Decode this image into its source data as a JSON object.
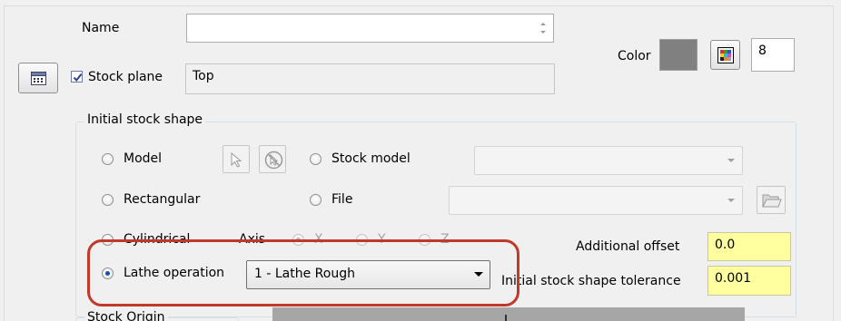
{
  "name": {
    "label": "Name",
    "value": ""
  },
  "color": {
    "label": "Color",
    "swatch": "#808080",
    "value": "8"
  },
  "stock_plane": {
    "label": "Stock plane",
    "checked": true,
    "value": "Top"
  },
  "initial_stock_shape": {
    "group_title": "Initial stock shape",
    "model_label": "Model",
    "stock_model_label": "Stock model",
    "stock_model_value": "",
    "rectangular_label": "Rectangular",
    "file_label": "File",
    "file_value": "",
    "cylindrical_label": "Cylindrical",
    "axis_label": "Axis",
    "axis_x": "X",
    "axis_y": "Y",
    "axis_z": "Z",
    "lathe_operation_label": "Lathe operation",
    "lathe_operation_value": "1 - Lathe Rough",
    "additional_offset_label": "Additional offset",
    "additional_offset_value": "0.0",
    "tolerance_label": "Initial stock shape tolerance",
    "tolerance_value": "0.001"
  },
  "stock_origin": {
    "group_title": "Stock Origin"
  },
  "colors": {
    "highlight": "#c0392b",
    "yellow_field": "#ffffa0"
  }
}
